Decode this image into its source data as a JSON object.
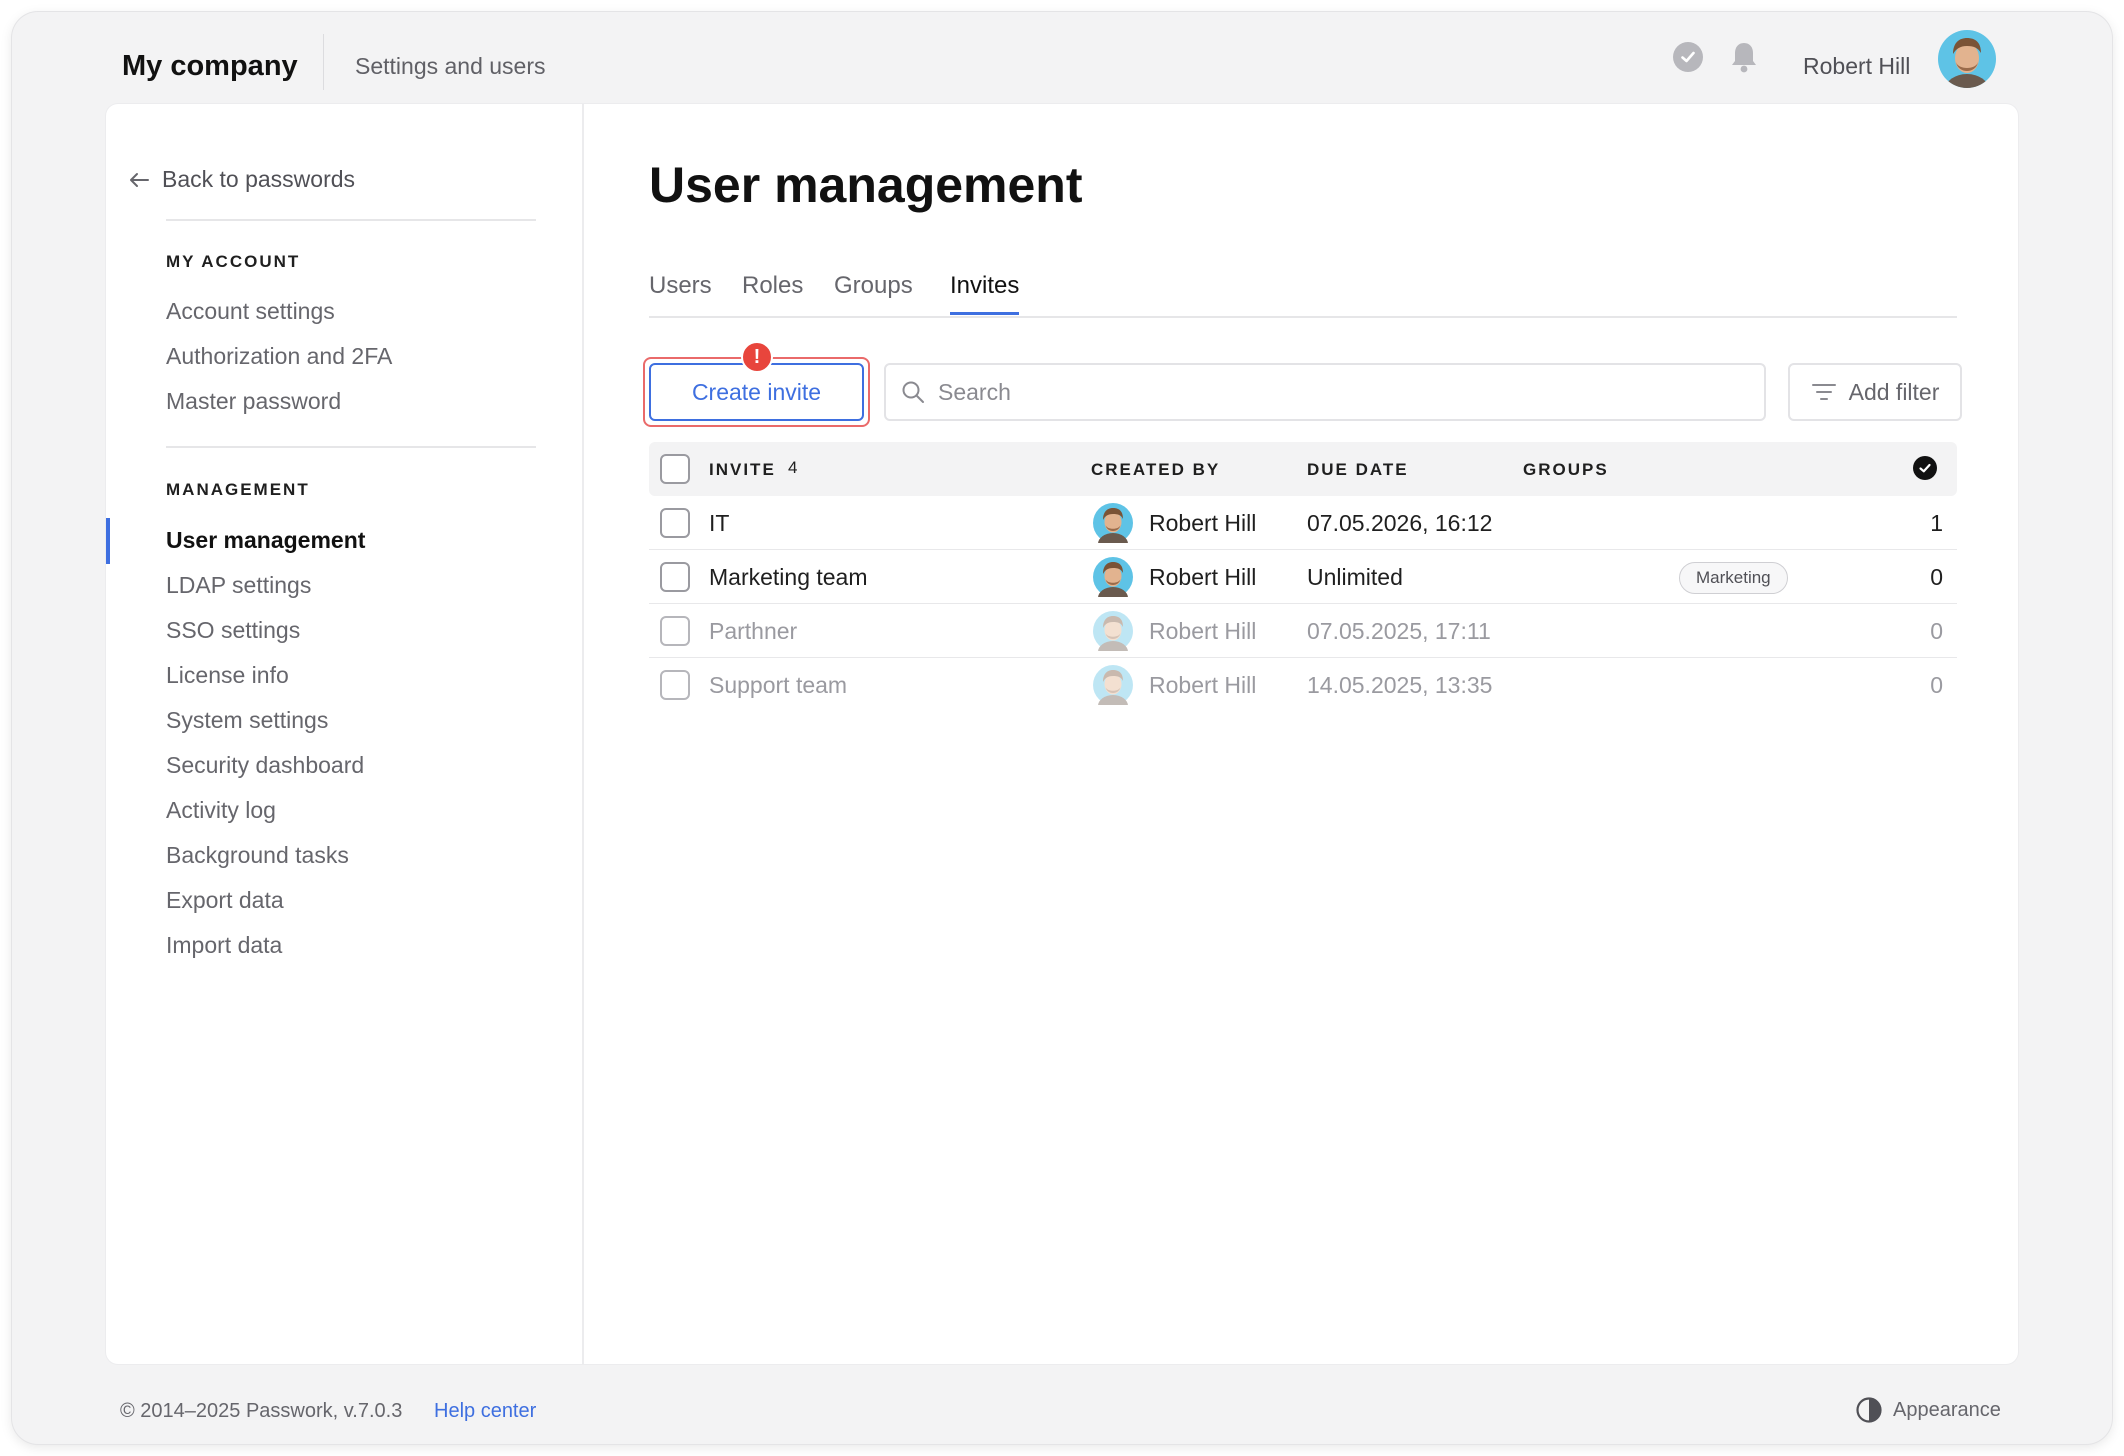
{
  "header": {
    "brand": "My company",
    "crumb": "Settings and users",
    "user_name": "Robert Hill",
    "check_icon": "check-circle-icon",
    "bell_icon": "bell-icon"
  },
  "sidebar": {
    "back_label": "Back to passwords",
    "sections": [
      {
        "heading": "MY ACCOUNT",
        "items": [
          "Account settings",
          "Authorization and 2FA",
          "Master password"
        ]
      },
      {
        "heading": "MANAGEMENT",
        "items": [
          "User management",
          "LDAP settings",
          "SSO settings",
          "License info",
          "System settings",
          "Security dashboard",
          "Activity log",
          "Background tasks",
          "Export data",
          "Import data"
        ]
      }
    ],
    "active_item": "User management"
  },
  "main": {
    "title": "User management",
    "tabs": [
      "Users",
      "Roles",
      "Groups",
      "Invites"
    ],
    "active_tab": "Invites",
    "create_label": "Create invite",
    "alert_badge": "!",
    "search_placeholder": "Search",
    "filter_label": "Add filter",
    "table": {
      "headers": {
        "invite": "INVITE",
        "invite_count": "4",
        "created_by": "CREATED BY",
        "due_date": "DUE DATE",
        "groups": "GROUPS"
      },
      "rows": [
        {
          "name": "IT",
          "created_by": "Robert Hill",
          "due_date": "07.05.2026, 16:12",
          "group": "",
          "count": "1",
          "state": "active"
        },
        {
          "name": "Marketing team",
          "created_by": "Robert Hill",
          "due_date": "Unlimited",
          "group": "Marketing",
          "count": "0",
          "state": "active"
        },
        {
          "name": "Parthner",
          "created_by": "Robert Hill",
          "due_date": "07.05.2025, 17:11",
          "group": "",
          "count": "0",
          "state": "expired"
        },
        {
          "name": "Support team",
          "created_by": "Robert Hill",
          "due_date": "14.05.2025, 13:35",
          "group": "",
          "count": "0",
          "state": "expired"
        }
      ]
    }
  },
  "footer": {
    "copyright": "© 2014–2025 Passwork, v.7.0.3",
    "help": "Help center",
    "appearance": "Appearance"
  },
  "colors": {
    "accent": "#3e6fe0",
    "alert": "#e8453c",
    "outline_highlight": "#ea6a6a"
  }
}
